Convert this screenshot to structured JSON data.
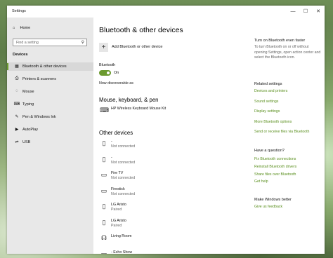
{
  "window": {
    "title": "Settings",
    "minimize": "—",
    "maximize": "☐",
    "close": "✕"
  },
  "sidebar": {
    "home": "Home",
    "search_placeholder": "Find a setting",
    "section": "Devices",
    "items": [
      {
        "label": "Bluetooth & other devices",
        "icon": "bluetooth-devices-icon",
        "glyph": "▦",
        "active": true
      },
      {
        "label": "Printers & scanners",
        "icon": "printer-icon",
        "glyph": "⎙",
        "active": false
      },
      {
        "label": "Mouse",
        "icon": "mouse-icon",
        "glyph": "◌",
        "active": false
      },
      {
        "label": "Typing",
        "icon": "keyboard-icon",
        "glyph": "⌨",
        "active": false
      },
      {
        "label": "Pen & Windows Ink",
        "icon": "pen-icon",
        "glyph": "✎",
        "active": false
      },
      {
        "label": "AutoPlay",
        "icon": "autoplay-icon",
        "glyph": "▶",
        "active": false
      },
      {
        "label": "USB",
        "icon": "usb-icon",
        "glyph": "⇌",
        "active": false
      }
    ]
  },
  "main": {
    "title": "Bluetooth & other devices",
    "add_label": "Add Bluetooth or other device",
    "bluetooth_label": "Bluetooth",
    "toggle_state": "On",
    "discoverable": "Now discoverable as",
    "mkp_heading": "Mouse, keyboard, & pen",
    "mkp_devices": [
      {
        "name": "HP Wireless Keyboard Mouse Kit",
        "status": "",
        "glyph": "⌨"
      }
    ],
    "other_heading": "Other devices",
    "other_devices": [
      {
        "name": "-",
        "status": "Not connected",
        "glyph": "▯"
      },
      {
        "name": "-",
        "status": "Not connected",
        "glyph": "▯"
      },
      {
        "name": "Fire TV",
        "status": "Not connected",
        "glyph": "▭"
      },
      {
        "name": "Firestick",
        "status": "Not connected",
        "glyph": "▭"
      },
      {
        "name": "LG Aristo",
        "status": "Paired",
        "glyph": "▯"
      },
      {
        "name": "LG Aristo",
        "status": "Paired",
        "glyph": "▯"
      },
      {
        "name": "Living Room",
        "status": "",
        "glyph": "☊"
      },
      {
        "name": "-          Echo Show",
        "status": "",
        "glyph": "▭"
      }
    ]
  },
  "right": {
    "tip_heading": "Turn on Bluetooth even faster",
    "tip_text": "To turn Bluetooth on or off without opening Settings, open action center and select the Bluetooth icon.",
    "related_heading": "Related settings",
    "related_links": [
      "Devices and printers",
      "Sound settings",
      "Display settings",
      "More Bluetooth options",
      "Send or receive files via Bluetooth"
    ],
    "question_heading": "Have a question?",
    "question_links": [
      "Fix Bluetooth connections",
      "Reinstall Bluetooth drivers",
      "Share files over Bluetooth",
      "Get help"
    ],
    "better_heading": "Make Windows better",
    "better_link": "Give us feedback"
  }
}
